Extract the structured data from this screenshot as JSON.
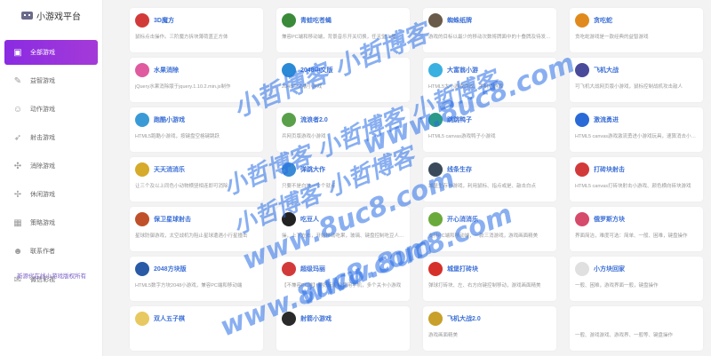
{
  "brand": {
    "title": "小游戏平台"
  },
  "sidebar": {
    "items": [
      {
        "label": "全部游戏",
        "icon": "monitor-icon",
        "glyph": "▣",
        "active": true
      },
      {
        "label": "益智游戏",
        "icon": "graduation-cap-icon",
        "glyph": "✎"
      },
      {
        "label": "动作游戏",
        "icon": "reddit-icon",
        "glyph": "☺"
      },
      {
        "label": "射击游戏",
        "icon": "rocket-icon",
        "glyph": "➶"
      },
      {
        "label": "消除游戏",
        "icon": "puzzle-icon",
        "glyph": "✣"
      },
      {
        "label": "休闲游戏",
        "icon": "compass-icon",
        "glyph": "✢"
      },
      {
        "label": "策略游戏",
        "icon": "cubes-icon",
        "glyph": "▦"
      },
      {
        "label": "联系作者",
        "icon": "user-icon",
        "glyph": "☻"
      },
      {
        "label": "微信彩视",
        "icon": "chat-icon",
        "glyph": "✉"
      }
    ],
    "footer": "新源代在线小游戏版权所有"
  },
  "games": [
    {
      "title": "3D魔方",
      "desc": "鼠标点击操作。三阶魔方拆块薄荷盖正方体",
      "color": "#d23a3a"
    },
    {
      "title": "青蛙吃苍蝇",
      "desc": "兼容PC端和移动端，背景音乐开关切换，任天堂上周神背景",
      "color": "#3a8a3a"
    },
    {
      "title": "蜘蛛纸牌",
      "desc": "游戏的目标以最少的移动次数将牌面中的十叠牌及待发的五组",
      "color": "#6a5a4a"
    },
    {
      "title": "贪吃蛇",
      "desc": "贪吃蛇游戏是一款经典的益智游戏",
      "color": "#e08a1e"
    },
    {
      "title": "水果消除",
      "desc": "jQuery水果消除版于jquery.1.10.2.min.js制作",
      "color": "#e05aa0"
    },
    {
      "title": "2048中文版",
      "desc": "2048中文版小游戏",
      "color": "#2a8ad6"
    },
    {
      "title": "大富翁小游",
      "desc": "HTML5大小游戏游戏、手机小游戏",
      "color": "#3ab0e0"
    },
    {
      "title": "飞机大战",
      "desc": "可飞机大战网页版小游戏，鼠标控制战机攻击敌人",
      "color": "#4a4a9a"
    },
    {
      "title": "跑酷小游戏",
      "desc": "HTML5跑酷小游戏，按键盘空格键跳跃",
      "color": "#3a9ad6"
    },
    {
      "title": "流浪者2.0",
      "desc": "兵网页版游戏小游戏",
      "color": "#5aa04a"
    },
    {
      "title": "跳跳鸭子",
      "desc": "HTML5 canvas游戏鸭子小游戏",
      "color": "#2a9a8a"
    },
    {
      "title": "激流勇进",
      "desc": "HTML5 canvas游戏激流勇进小游戏玩具，速算消去小游戏",
      "color": "#2a6ad6"
    },
    {
      "title": "天天消消乐",
      "desc": "让三个及以上同色小动物横竖相连即可消除",
      "color": "#d6aa2a"
    },
    {
      "title": "弹跳大作",
      "desc": "只要不是白块一个个就点",
      "color": "#3a8ad6"
    },
    {
      "title": "线条生存",
      "desc": "城堡生存与游戏，利用鼠标、指点或是、敲击白点",
      "color": "#3a4a5a"
    },
    {
      "title": "打砖块射击",
      "desc": "HTML5 canvas打砖块射击小游戏、颜色横向砖块游戏",
      "color": "#d23a3a"
    },
    {
      "title": "保卫星球射击",
      "desc": "星球防御游戏，太空战机为阻止星球遭遇小行星撞击",
      "color": "#c0502a"
    },
    {
      "title": "吃豆人",
      "desc": "操，上下左右，开始移动吃果，玻璃、键盘控制吃豆人游戏",
      "color": "#222222"
    },
    {
      "title": "开心消消乐",
      "desc": "支持PC端和移动端，一款三消游戏，游戏画面精美",
      "color": "#6aaa3a"
    },
    {
      "title": "俄罗斯方块",
      "desc": "界面简洁，难度可选：简单、一般、困难，键盘操作",
      "color": "#d64a6a"
    },
    {
      "title": "2048方块版",
      "desc": "HTML5数字方块2048小游戏，兼容PC端和移动端",
      "color": "#2a5aa6"
    },
    {
      "title": "超级玛丽",
      "desc": "【不兼容PC端】要好玩能会使用手机，多个关卡小游戏",
      "color": "#d23a3a"
    },
    {
      "title": "城堡打砖块",
      "desc": "弹球打砖块、左、右方向键控制移动，游戏画面精美",
      "color": "#d6302a"
    },
    {
      "title": "小方块回家",
      "desc": "一般、困难，游戏界面一般，键盘操作",
      "color": "#e0e0e0"
    },
    {
      "title": "双人五子棋",
      "desc": "",
      "color": "#e8c860"
    },
    {
      "title": "射箭小游戏",
      "desc": "",
      "color": "#2a2a2a"
    },
    {
      "title": "飞机大战2.0",
      "desc": "游戏画面精美",
      "color": "#c8a02a"
    },
    {
      "title": "",
      "desc": "一般、游戏游戏、游戏界、一般等、键盘操作",
      "color": "#ffffff"
    }
  ],
  "watermarks": [
    {
      "text": "小哲博客 小哲博客"
    },
    {
      "text": "小哲博客 小哲博客 小哲博客"
    },
    {
      "text": "小哲博客 小哲博客"
    },
    {
      "text": "www.8uc8.com"
    },
    {
      "text": "www.8uc8.com"
    },
    {
      "text": "www.8uc8.com"
    },
    {
      "text": "www.8uc8.com"
    }
  ]
}
